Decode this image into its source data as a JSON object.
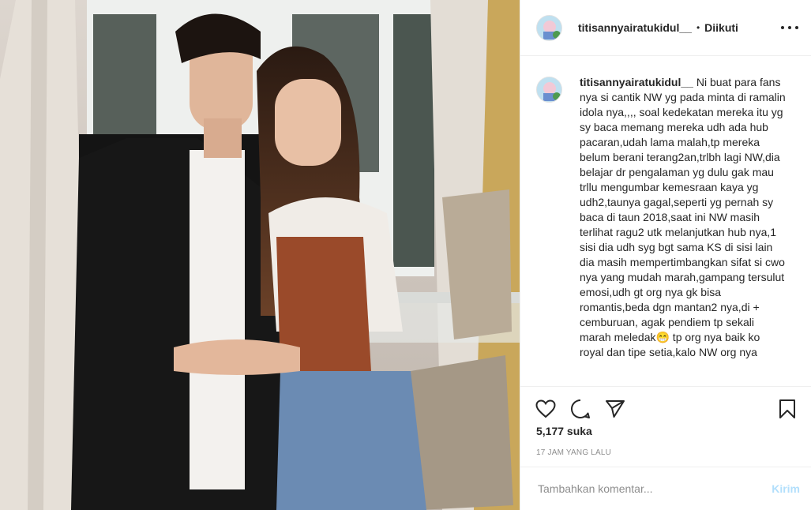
{
  "post": {
    "username": "titisannyairatukidul__",
    "follow_separator": "•",
    "follow_label": "Diikuti",
    "more_icon": "more-options-icon",
    "caption": "Ni buat para fans nya si cantik NW yg pada minta di ramalin idola nya,,,, soal kedekatan mereka itu yg sy baca memang mereka udh ada hub pacaran,udah lama malah,tp mereka belum berani terang2an,trlbh lagi NW,dia belajar dr pengalaman yg dulu gak mau trllu mengumbar kemesraan kaya yg udh2,taunya gagal,seperti yg pernah sy baca di taun 2018,saat ini NW masih terlihat ragu2 utk melanjutkan hub nya,1 sisi dia udh syg bgt sama KS di sisi lain dia masih mempertimbangkan sifat si cwo nya yang mudah marah,gampang tersulut emosi,udh gt org nya gk bisa romantis,beda dgn mantan2 nya,di + cemburuan, agak pendiem tp sekali marah meledak😁 tp org nya baik ko royal dan tipe setia,kalo NW org nya",
    "likes": "5,177 suka",
    "timestamp": "17 JAM YANG LALU"
  },
  "actions": {
    "like_icon": "heart-icon",
    "comment_icon": "comment-icon",
    "share_icon": "share-icon",
    "save_icon": "bookmark-icon"
  },
  "comment_box": {
    "placeholder": "Tambahkan komentar...",
    "post_label": "Kirim"
  },
  "colors": {
    "text": "#262626",
    "muted": "#8e8e8e",
    "divider": "#efefef",
    "post_disabled": "#b2dffc"
  }
}
